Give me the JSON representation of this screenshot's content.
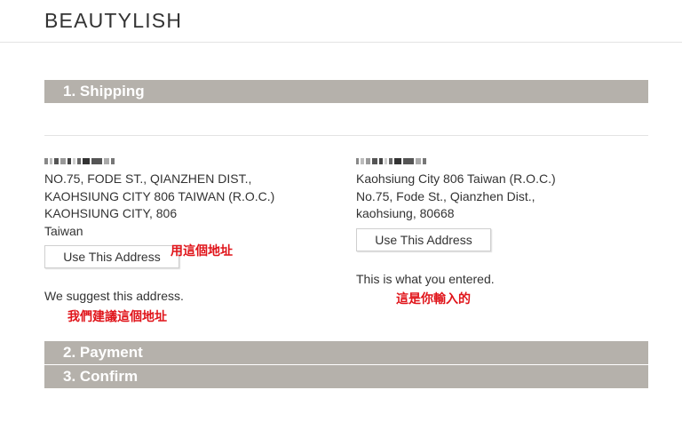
{
  "header": {
    "logo": "BEAUTYLISH"
  },
  "steps": {
    "shipping": "1. Shipping",
    "payment": "2. Payment",
    "confirm": "3. Confirm"
  },
  "suggested": {
    "lines": [
      "NO.75, FODE ST., QIANZHEN DIST.,",
      "KAOHSIUNG CITY 806 TAIWAN (R.O.C.)",
      "KAOHSIUNG CITY, 806",
      "Taiwan"
    ],
    "button": "Use This Address",
    "note": "We suggest this address."
  },
  "entered": {
    "lines": [
      "Kaohsiung City 806 Taiwan (R.O.C.)",
      "No.75, Fode St., Qianzhen Dist.,",
      "kaohsiung, 80668"
    ],
    "button": "Use This Address",
    "note": "This is what you entered."
  },
  "annotations": {
    "use_this_address": "用這個地址",
    "we_suggest": "我們建議這個地址",
    "you_entered": "這是你輸入的"
  },
  "colors": {
    "bar": "#b5b1ab",
    "annotation": "#e0141a"
  }
}
